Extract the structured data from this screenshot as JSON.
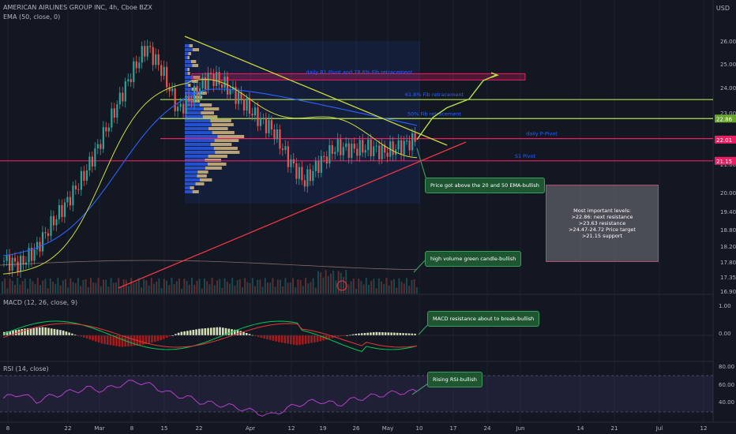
{
  "header": {
    "symbol_line": "AMERICAN AIRLINES GROUP INC, 4h, Cboe BZX",
    "ema_line": "EMA (50, close, 0)",
    "macd_line": "MACD (12, 26, close, 9)",
    "rsi_line": "RSI (14, close)",
    "currency": "USD"
  },
  "colors": {
    "background": "#131722",
    "up": "#26a69a",
    "down": "#ef5350",
    "ema50": "#2962ff",
    "ma20": "#cddc39",
    "level_green": "#b5e24b",
    "pivot_red": "#e91e63",
    "trend_red": "#f23645",
    "rsi": "#b540c8",
    "macd": "#00c853",
    "signal": "#e53935"
  },
  "chart_data": [
    {
      "type": "candlestick",
      "title": "AMERICAN AIRLINES GROUP INC, 4h, Cboe BZX",
      "y_axis_labels": [
        "26.00",
        "25.00",
        "24.00",
        "23.00",
        "22.00",
        "21.00",
        "20.00",
        "19.40",
        "18.80",
        "18.20",
        "17.80",
        "17.35",
        "16.90"
      ],
      "x_axis_labels": [
        "8",
        "22",
        "Mar",
        "8",
        "15",
        "22",
        "Apr",
        "12",
        "19",
        "26",
        "May",
        "10",
        "17",
        "24",
        "Jun",
        "14",
        "21",
        "Jul",
        "12"
      ],
      "price_tags": [
        {
          "value": "22.86",
          "kind": "level"
        },
        {
          "value": "22.01",
          "kind": "last"
        },
        {
          "value": "21.15",
          "kind": "pivot"
        }
      ],
      "levels": [
        {
          "label": "daily R1 Pivot and 78.6% Fib retracement",
          "price": 24.55,
          "color": "#e91e63"
        },
        {
          "label": "61.8% Fib retracement",
          "price": 23.63,
          "color": "#b5e24b"
        },
        {
          "label": "50% Fib retracement",
          "price": 22.86,
          "color": "#b5e24b"
        },
        {
          "label": "daily P-Pivot",
          "price": 22.05,
          "color": "#e91e63"
        },
        {
          "label": "S1 Pivot",
          "price": 21.15,
          "color": "#e91e63"
        }
      ],
      "close_path": [
        [
          "8",
          17.1
        ],
        [
          "14",
          16.95
        ],
        [
          "22",
          17.55
        ],
        [
          "Mar",
          18.6
        ],
        [
          "4",
          19.5
        ],
        [
          "8",
          20.5
        ],
        [
          "11",
          21.8
        ],
        [
          "15",
          23.2
        ],
        [
          "18",
          24.6
        ],
        [
          "20",
          25.8
        ],
        [
          "22",
          24.8
        ],
        [
          "25",
          23.2
        ],
        [
          "29",
          23.8
        ],
        [
          "Apr",
          24.6
        ],
        [
          "5",
          24.2
        ],
        [
          "8",
          23.6
        ],
        [
          "12",
          22.9
        ],
        [
          "15",
          22.4
        ],
        [
          "19",
          21.2
        ],
        [
          "21",
          20.3
        ],
        [
          "23",
          21.1
        ],
        [
          "26",
          21.7
        ],
        [
          "29",
          21.6
        ],
        [
          "May",
          21.7
        ],
        [
          "5",
          21.5
        ],
        [
          "8",
          21.7
        ],
        [
          "10",
          22.01
        ]
      ],
      "projection_path": [
        22.01,
        22.9,
        23.3,
        23.65,
        24.4,
        24.62
      ]
    },
    {
      "type": "bar",
      "title": "MACD (12, 26, close, 9)",
      "y_axis_labels": [
        "1.00",
        "0.00"
      ],
      "histogram_sample": [
        0.1,
        0.2,
        0.25,
        0.15,
        -0.05,
        -0.25,
        -0.35,
        -0.3,
        -0.15,
        0.1,
        0.2,
        0.25,
        0.15,
        -0.05,
        -0.2,
        -0.3,
        -0.2,
        -0.05,
        0.05,
        0.1,
        0.08,
        0.05
      ],
      "annotation": "MACD resistance about to break-bullish"
    },
    {
      "type": "line",
      "title": "RSI (14, close)",
      "y_axis_labels": [
        "80.00",
        "60.00",
        "40.00"
      ],
      "overbought": 70,
      "oversold": 30,
      "values_sample": [
        55,
        60,
        52,
        58,
        62,
        66,
        64,
        70,
        74,
        68,
        60,
        56,
        50,
        48,
        45,
        40,
        36,
        44,
        50,
        52,
        48,
        54,
        57,
        60,
        62
      ]
    }
  ],
  "annotations": {
    "ema_callout": "Price got above the 20 and 50 EMA-bullish",
    "volume_callout": "high volume green candle-bullish",
    "macd_callout": "MACD resistance about to break-bullish",
    "rsi_callout": "Rising RSI-bullish",
    "levels_box": {
      "title": "Most important levels:",
      "lines": [
        ">22.86: next resistance",
        ">23.63 resistance",
        ">24.47-24.72 Price target",
        ">21.15 support"
      ]
    }
  }
}
